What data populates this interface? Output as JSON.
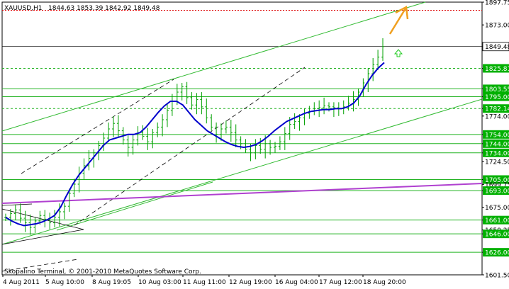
{
  "header": {
    "symbol": "XAUUSD,H1",
    "ohlc": "1844.63 1853.39 1842.92 1849.48"
  },
  "copyright": "Skopalino Terminal, © 2001-2010 MetaQuotes Software Corp.",
  "colors": {
    "background": "#ffffff",
    "axis": "#000000",
    "candles": "#00a000",
    "support_resistance_lines": "#22b322",
    "channel_lines": "#33bb33",
    "dashed_channel": "#000000",
    "moving_average": "#0000cc",
    "trend_line": "#b040d0",
    "forecast_arrow": "#f0a020",
    "up_arrow": "#22cc22",
    "red_line": "#dd0000",
    "red_label_bg": "#dd0000",
    "current_price_label_bg": "#ffffff",
    "level_label_bg": "#00b000",
    "level_label_text": "#ffffff"
  },
  "chart_data": {
    "type": "candlestick",
    "title": "XAUUSD,H1",
    "x_tick_labels": [
      "4 Aug 2011",
      "5 Aug 10:00",
      "8 Aug 19:05",
      "10 Aug 03:00",
      "11 Aug 11:00",
      "12 Aug 19:00",
      "16 Aug 04:00",
      "17 Aug 12:00",
      "18 Aug 20:00"
    ],
    "y_tick_labels": [
      "1897.75",
      "1873.00",
      "1849.48",
      "1825.81",
      "1803.55",
      "1795.00",
      "1782.14",
      "1774.00",
      "1754.00",
      "1744.00",
      "1734.00",
      "1724.50",
      "1705.00",
      "1699.75",
      "1693.00",
      "1675.00",
      "1661.00",
      "1650.25",
      "1646.00",
      "1626.00",
      "1601.50"
    ],
    "ylim": [
      1601.5,
      1897.75
    ],
    "current_price": 1849.48,
    "red_level": 1888.92,
    "horizontal_levels": [
      1825.81,
      1803.55,
      1795.0,
      1782.14,
      1754.0,
      1744.0,
      1734.0,
      1705.0,
      1693.0,
      1661.0,
      1646.0,
      1626.0
    ],
    "close_series": [
      1664,
      1668,
      1672,
      1663,
      1658,
      1653,
      1660,
      1666,
      1662,
      1658,
      1664,
      1670,
      1676,
      1690,
      1700,
      1712,
      1720,
      1728,
      1734,
      1742,
      1750,
      1760,
      1766,
      1758,
      1748,
      1740,
      1748,
      1756,
      1752,
      1746,
      1756,
      1762,
      1770,
      1780,
      1790,
      1800,
      1806,
      1794,
      1786,
      1792,
      1784,
      1772,
      1762,
      1754,
      1760,
      1762,
      1756,
      1748,
      1744,
      1738,
      1734,
      1742,
      1738,
      1744,
      1740,
      1741,
      1746,
      1755,
      1765,
      1768,
      1772,
      1777,
      1779,
      1782,
      1783,
      1785,
      1784,
      1783,
      1782,
      1784,
      1788,
      1792,
      1800,
      1810,
      1820,
      1830,
      1838,
      1849.48
    ],
    "moving_average": [
      1664,
      1660,
      1657,
      1655,
      1656,
      1657,
      1659,
      1662,
      1666,
      1675,
      1688,
      1700,
      1710,
      1718,
      1726,
      1734,
      1742,
      1748,
      1750,
      1752,
      1754,
      1754,
      1756,
      1762,
      1770,
      1778,
      1785,
      1790,
      1790,
      1786,
      1778,
      1770,
      1764,
      1758,
      1754,
      1750,
      1746,
      1743,
      1741,
      1740,
      1741,
      1743,
      1747,
      1752,
      1758,
      1763,
      1768,
      1771,
      1774,
      1777,
      1779,
      1780,
      1781,
      1781,
      1782,
      1782,
      1784,
      1788,
      1796,
      1808,
      1818,
      1826,
      1832
    ]
  }
}
